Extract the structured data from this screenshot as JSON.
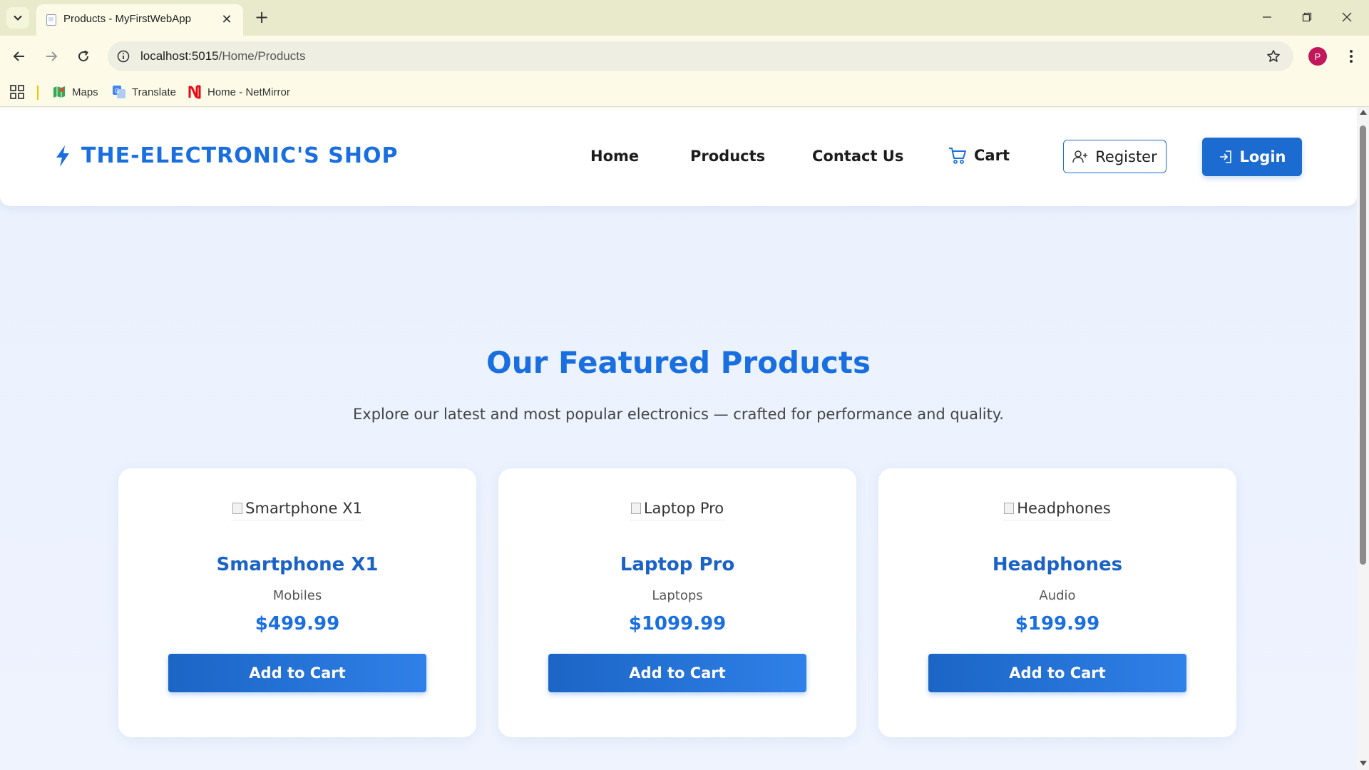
{
  "browser": {
    "tab_title": "Products - MyFirstWebApp",
    "url_host": "localhost:5015",
    "url_path": "/Home/Products",
    "profile_initial": "P",
    "bookmarks": [
      {
        "label": "Maps",
        "icon": "maps-icon"
      },
      {
        "label": "Translate",
        "icon": "translate-icon"
      },
      {
        "label": "Home - NetMirror",
        "icon": "netmirror-icon"
      }
    ]
  },
  "site": {
    "logo": "THE-ELECTRONIC'S SHOP",
    "brand_color": "#1a6fe0",
    "nav": {
      "home": "Home",
      "products": "Products",
      "contact": "Contact Us",
      "cart": "Cart",
      "register": "Register",
      "login": "Login"
    }
  },
  "main": {
    "title": "Our Featured Products",
    "subtitle": "Explore our latest and most popular electronics — crafted for performance and quality.",
    "products": [
      {
        "image_alt": "Smartphone X1",
        "name": "Smartphone X1",
        "category": "Mobiles",
        "price": "$499.99",
        "button": "Add to Cart"
      },
      {
        "image_alt": "Laptop Pro",
        "name": "Laptop Pro",
        "category": "Laptops",
        "price": "$1099.99",
        "button": "Add to Cart"
      },
      {
        "image_alt": "Headphones",
        "name": "Headphones",
        "category": "Audio",
        "price": "$199.99",
        "button": "Add to Cart"
      }
    ]
  }
}
